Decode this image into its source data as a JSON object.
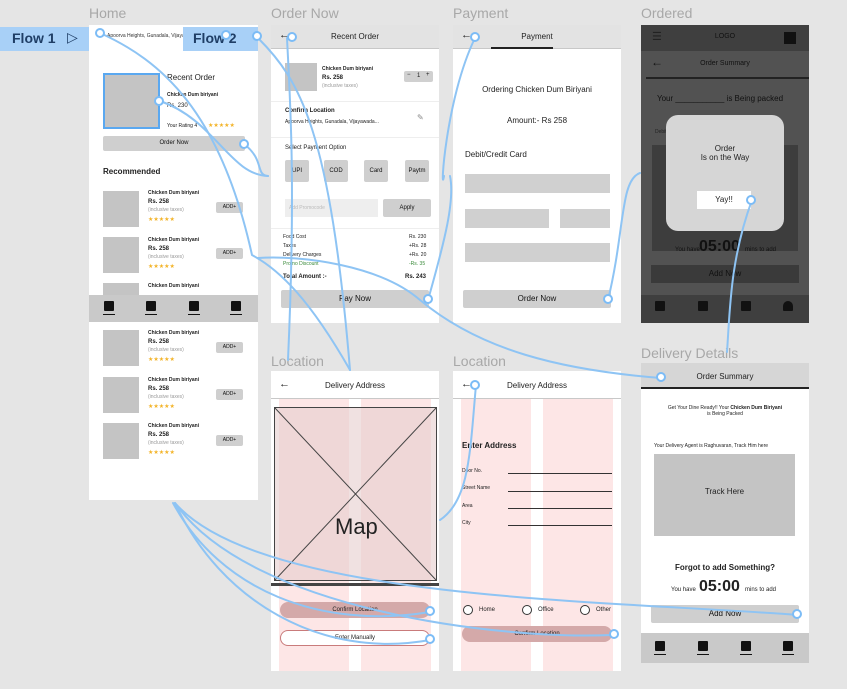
{
  "labels": {
    "home": "Home",
    "order_now": "Order Now",
    "payment": "Payment",
    "ordered": "Ordered",
    "location1": "Location",
    "location2": "Location",
    "delivery_details": "Delivery Details"
  },
  "flows": {
    "flow1": "Flow 1",
    "flow2": "Flow 2",
    "play_icon": "play-triangle-icon"
  },
  "home": {
    "address": "Apoorva Heights, Gunadala, Vijayawada",
    "recent_title": "Recent Order",
    "recent_item": "Chicken Dum biriyani",
    "recent_price": "Rs. 230",
    "rating_label": "Your Rating 4",
    "rating_stars": "★★★★★",
    "order_now": "Order Now",
    "recommended": "Recommended",
    "items": [
      {
        "name": "Chicken Dum biriyani",
        "price": "Rs. 258",
        "tax": "(inclusive taxes)",
        "stars": "★★★★★",
        "add": "ADD+"
      },
      {
        "name": "Chicken Dum biriyani",
        "price": "Rs. 258",
        "tax": "(inclusive taxes)",
        "stars": "★★★★★",
        "add": "ADD+"
      },
      {
        "name": "Chicken Dum biriyani",
        "price": "",
        "tax": "",
        "stars": "",
        "add": ""
      }
    ],
    "items2": [
      {
        "name": "Chicken Dum biriyani",
        "price": "Rs. 258",
        "tax": "(inclusive taxes)",
        "stars": "★★★★★",
        "add": "ADD+"
      },
      {
        "name": "Chicken Dum biriyani",
        "price": "Rs. 258",
        "tax": "(inclusive taxes)",
        "stars": "★★★★★",
        "add": "ADD+"
      },
      {
        "name": "Chicken Dum biriyani",
        "price": "Rs. 258",
        "tax": "(inclusive taxes)",
        "stars": "★★★★★",
        "add": "ADD+"
      }
    ]
  },
  "order": {
    "title": "Recent Order",
    "item": "Chicken Dum biriyani",
    "price": "Rs. 258",
    "tax": "(inclusive taxes)",
    "qty_minus": "−",
    "qty": "1",
    "qty_plus": "+",
    "confirm_location": "Confirm Location",
    "location": "Apoorva Heights, Gunadala, Vijayawada...",
    "select_payment": "Select Payment Option",
    "pay_options": [
      "UPI",
      "COD",
      "Card",
      "Paytm"
    ],
    "promo_placeholder": "Add Promocode",
    "apply": "Apply",
    "bill": [
      {
        "k": "Food Cost",
        "v": "Rs. 230"
      },
      {
        "k": "Taxes",
        "v": "+Rs. 28"
      },
      {
        "k": "Delivery Charges",
        "v": "+Rs. 20"
      },
      {
        "k": "Promo Discount",
        "v": "-Rs. 35"
      }
    ],
    "total_label": "Total Amount :-",
    "total_value": "Rs. 243",
    "pay_now": "Pay Now"
  },
  "payment": {
    "title": "Payment",
    "ordering": "Ordering Chicken Dum Biriyani",
    "amount": "Amount:- Rs 258",
    "card": "Debit/Credit Card",
    "order_now": "Order Now"
  },
  "ordered": {
    "logo": "LOGO",
    "title": "Order Summary",
    "your": "Your ___________ is Being packed",
    "debit": "Debit",
    "modal_line1": "Order",
    "modal_line2": "Is on the Way",
    "modal_btn": "Yay!!",
    "you_have": "You have",
    "timer": "05:00",
    "mins": "mins to add",
    "add_now": "Add Now"
  },
  "loc1": {
    "title": "Delivery Address",
    "map": "Map",
    "confirm": "Confirm Location",
    "manual": "Enter Manually"
  },
  "loc2": {
    "title": "Delivery Address",
    "enter": "Enter Address",
    "fields": [
      "Door No.",
      "Street Name",
      "Area",
      "City"
    ],
    "radios": [
      "Home",
      "Office",
      "Other"
    ],
    "confirm": "Confirm Location"
  },
  "details": {
    "title": "Order Summary",
    "msg_a": "Get Your Dine Ready!! Your",
    "msg_b": "Chicken Dum Biriyani",
    "msg_c": "is Being Packed",
    "agent": "Your Delivery Agent is Raghuvaran, Track Him here",
    "track": "Track Here",
    "forgot": "Forgot to add Something?",
    "you_have": "You have",
    "timer": "05:00",
    "mins": "mins to add",
    "add_now": "Add Now"
  }
}
